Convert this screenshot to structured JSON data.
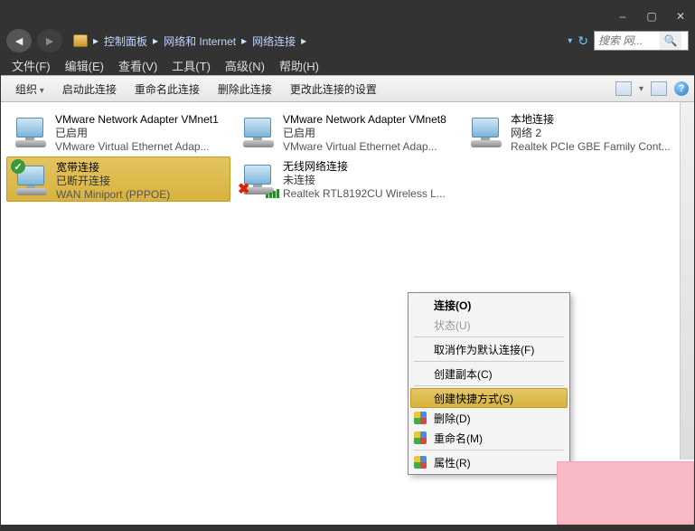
{
  "titlebar": {
    "minimize": "–",
    "maximize": "▢",
    "close": "✕"
  },
  "breadcrumb": {
    "parts": [
      "控制面板",
      "网络和 Internet",
      "网络连接"
    ]
  },
  "search": {
    "placeholder": "搜索 网..."
  },
  "menubar": [
    "文件(F)",
    "编辑(E)",
    "查看(V)",
    "工具(T)",
    "高级(N)",
    "帮助(H)"
  ],
  "toolbar": {
    "organize": "组织",
    "start": "启动此连接",
    "rename": "重命名此连接",
    "delete": "删除此连接",
    "change": "更改此连接的设置"
  },
  "connections": [
    {
      "name": "VMware Network Adapter VMnet1",
      "status": "已启用",
      "device": "VMware Virtual Ethernet Adap...",
      "overlay": "",
      "selected": false
    },
    {
      "name": "VMware Network Adapter VMnet8",
      "status": "已启用",
      "device": "VMware Virtual Ethernet Adap...",
      "overlay": "",
      "selected": false
    },
    {
      "name": "本地连接",
      "status": "网络  2",
      "device": "Realtek PCIe GBE Family Cont...",
      "overlay": "",
      "selected": false
    },
    {
      "name": "宽带连接",
      "status": "已断开连接",
      "device": "WAN Miniport (PPPOE)",
      "overlay": "check",
      "selected": true
    },
    {
      "name": "无线网络连接",
      "status": "未连接",
      "device": "Realtek RTL8192CU Wireless L...",
      "overlay": "wifi-x",
      "selected": false
    }
  ],
  "context_menu": [
    {
      "label": "连接(O)",
      "type": "top"
    },
    {
      "label": "状态(U)",
      "type": "disabled"
    },
    {
      "label": "",
      "type": "sep"
    },
    {
      "label": "取消作为默认连接(F)",
      "type": "normal"
    },
    {
      "label": "",
      "type": "sep"
    },
    {
      "label": "创建副本(C)",
      "type": "normal"
    },
    {
      "label": "",
      "type": "sep"
    },
    {
      "label": "创建快捷方式(S)",
      "type": "hover"
    },
    {
      "label": "删除(D)",
      "type": "shield"
    },
    {
      "label": "重命名(M)",
      "type": "shield"
    },
    {
      "label": "",
      "type": "sep"
    },
    {
      "label": "属性(R)",
      "type": "shield"
    }
  ]
}
